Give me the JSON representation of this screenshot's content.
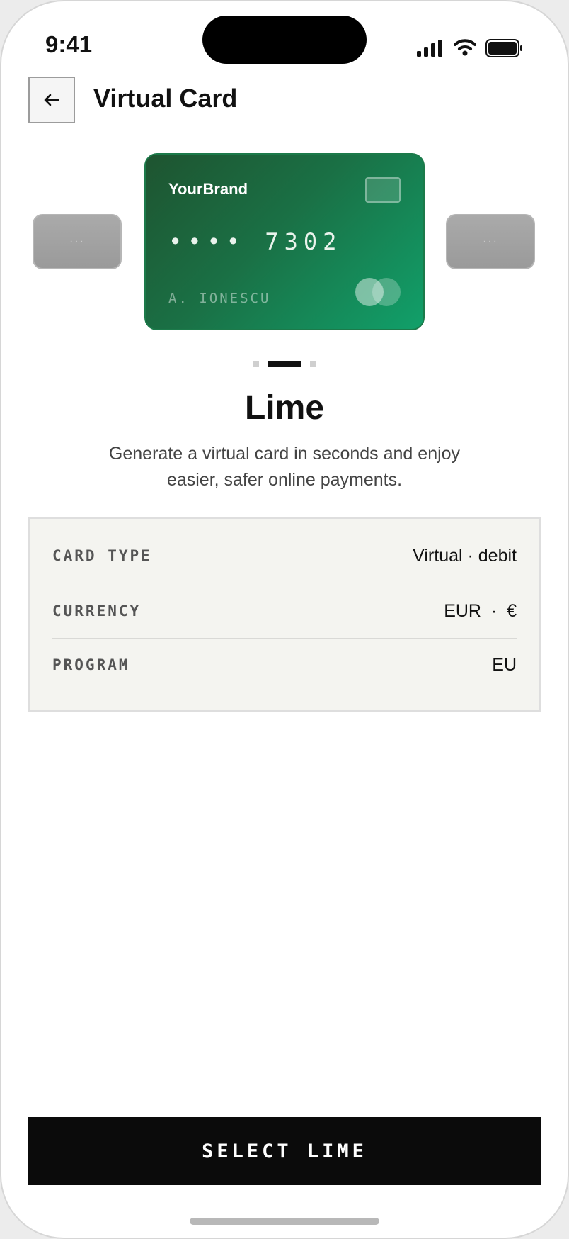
{
  "status_bar": {
    "time": "9:41"
  },
  "header": {
    "title": "Virtual Card",
    "back_icon": "arrow-left-icon"
  },
  "carousel": {
    "prev_card_text": "···",
    "next_card_text": "···",
    "card": {
      "brand": "YourBrand",
      "number": "•••• 7302",
      "holder": "A. IONESCU",
      "gradient_start": "#1e5430",
      "gradient_end": "#11a06a"
    },
    "pages": 3,
    "active_page": 2
  },
  "plan": {
    "name": "Lime",
    "description": "Generate a virtual card in seconds and enjoy easier, safer online payments."
  },
  "details": [
    {
      "label": "CARD TYPE",
      "value": "Virtual · debit"
    },
    {
      "label": "CURRENCY",
      "value": "EUR  ·  €"
    },
    {
      "label": "PROGRAM",
      "value": "EU"
    }
  ],
  "cta": {
    "label": "SELECT LIME",
    "color": "#0b0b0b"
  }
}
